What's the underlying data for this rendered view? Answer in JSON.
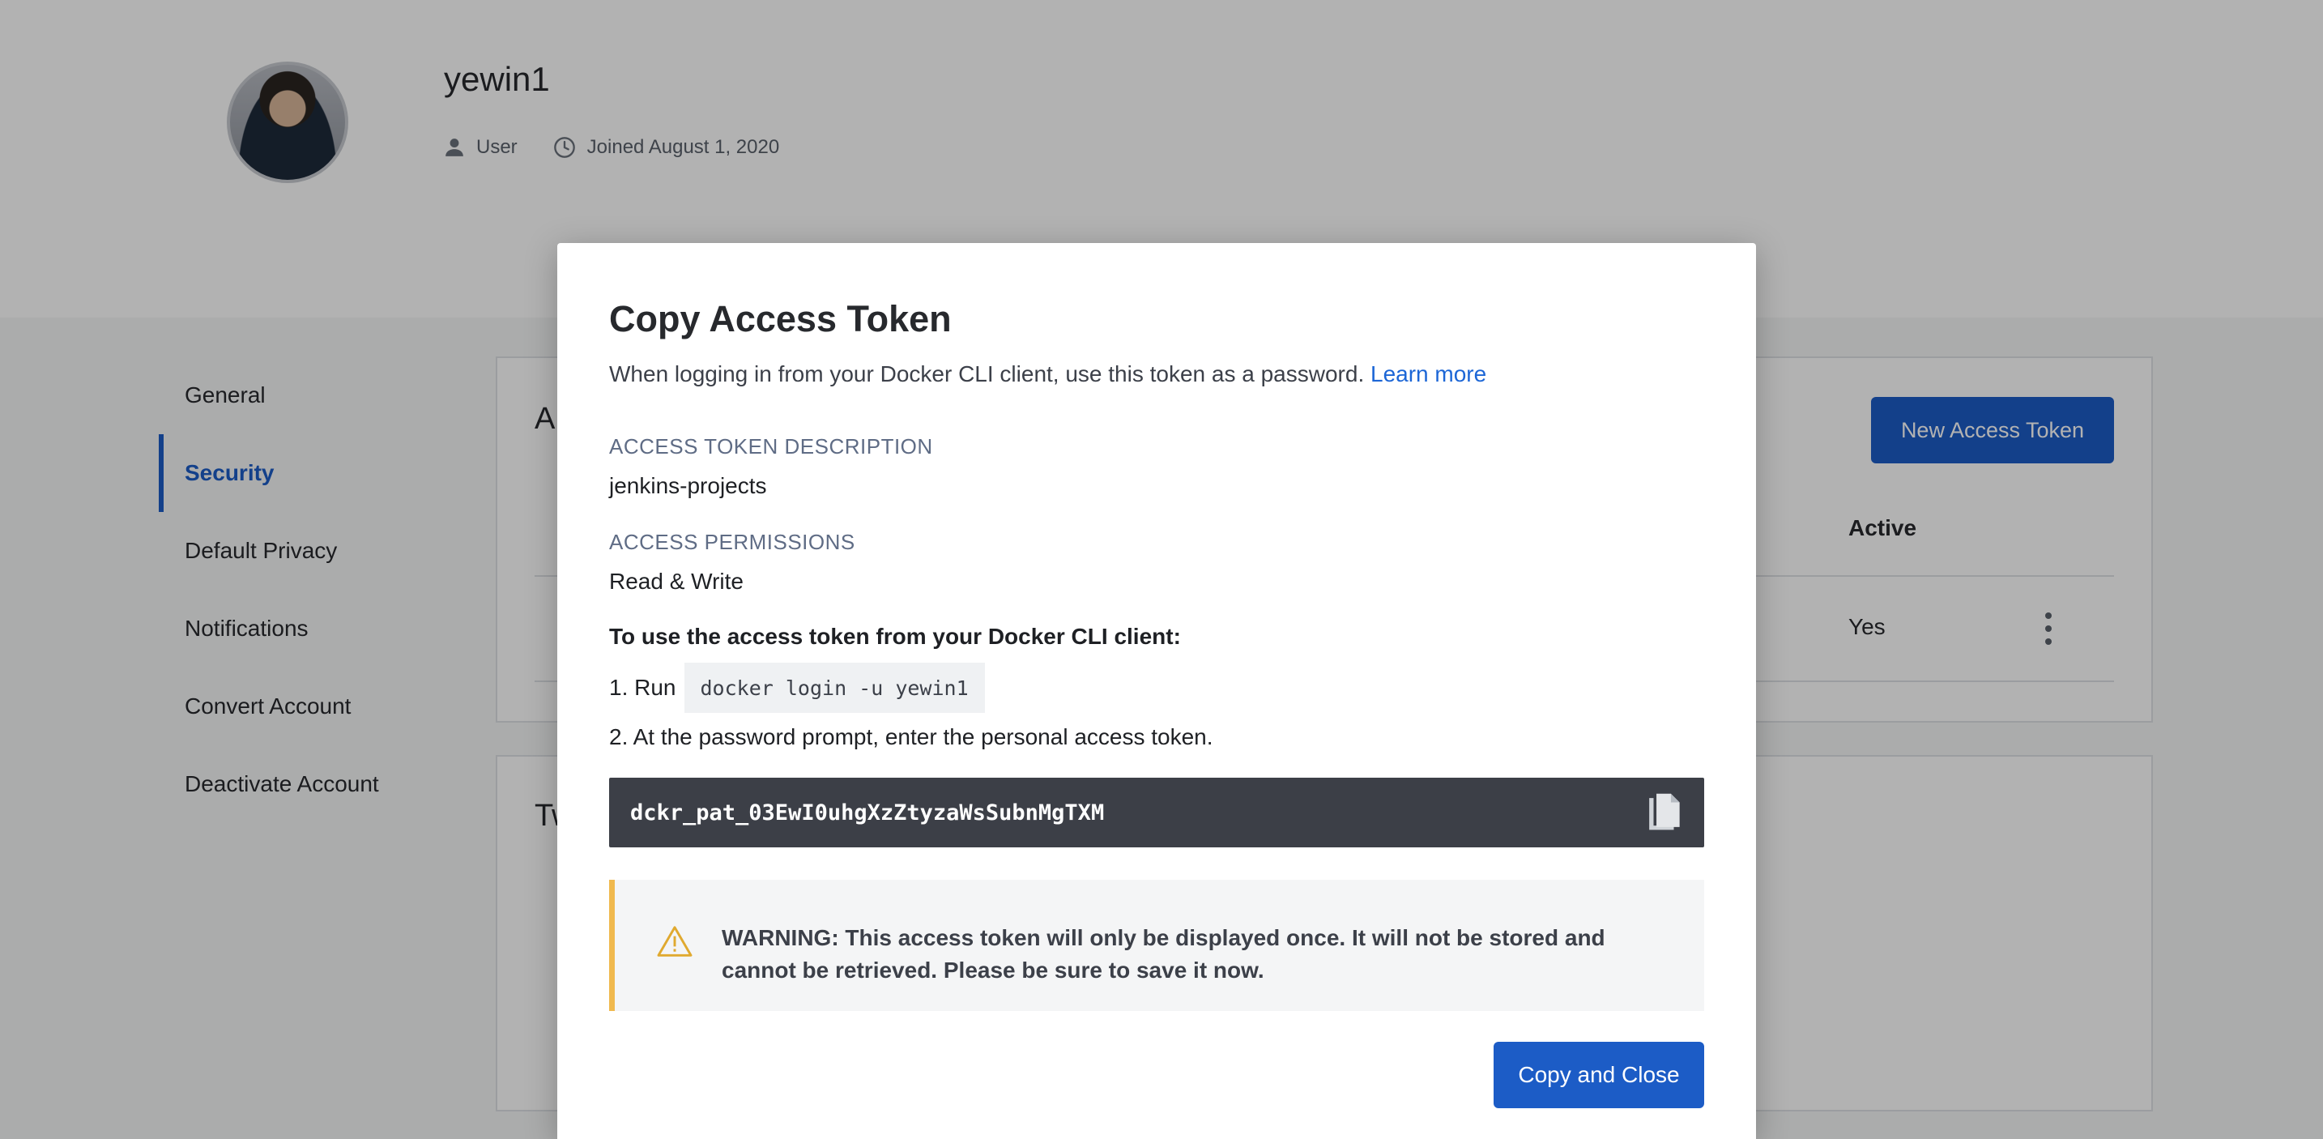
{
  "profile": {
    "username": "yewin1",
    "role": "User",
    "joined": "Joined August 1, 2020"
  },
  "sidebar": {
    "items": [
      {
        "label": "General"
      },
      {
        "label": "Security",
        "active": true
      },
      {
        "label": "Default Privacy"
      },
      {
        "label": "Notifications"
      },
      {
        "label": "Convert Account"
      },
      {
        "label": "Deactivate Account"
      }
    ]
  },
  "background": {
    "card1_heading_visible": "A",
    "card2_heading_visible": "Tw",
    "new_token_button": "New Access Token",
    "table": {
      "header_active": "Active",
      "row_active_value": "Yes"
    }
  },
  "modal": {
    "title": "Copy Access Token",
    "subtitle": "When logging in from your Docker CLI client, use this token as a password.",
    "learn_more": "Learn more",
    "description_label": "ACCESS TOKEN DESCRIPTION",
    "description_value": "jenkins-projects",
    "permissions_label": "ACCESS PERMISSIONS",
    "permissions_value": "Read & Write",
    "instructions_heading": "To use the access token from your Docker CLI client:",
    "step1_prefix": "1. Run",
    "step1_command": "docker login -u yewin1",
    "step2": "2. At the password prompt, enter the personal access token.",
    "token": "dckr_pat_03EwI0uhgXzZtyzaWsSubnMgTXM",
    "warning": "WARNING: This access token will only be displayed once. It will not be stored and cannot be retrieved. Please be sure to save it now.",
    "copy_close_button": "Copy and Close"
  },
  "colors": {
    "accent": "#1c5cc6",
    "link": "#1c66d6",
    "warning_bar": "#f0b94e",
    "token_bg": "#3c3f47"
  }
}
